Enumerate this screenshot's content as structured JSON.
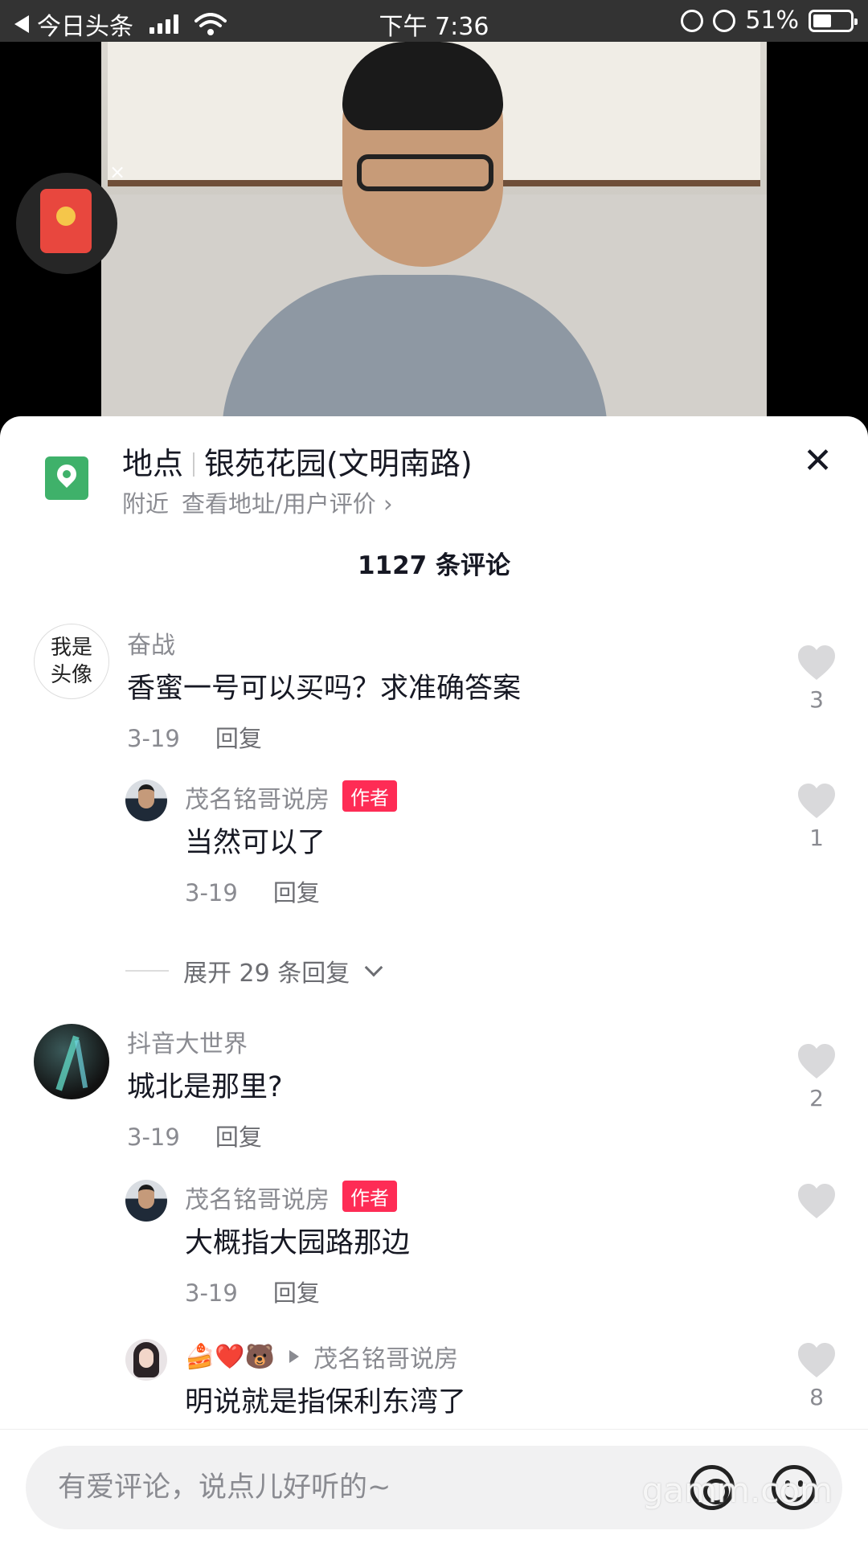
{
  "status_bar": {
    "app_name": "今日头条",
    "time": "下午 7:36",
    "battery": "51%",
    "battery_level": 0.51
  },
  "video": {
    "packet_close": "×"
  },
  "location": {
    "label": "地点",
    "name": "银苑花园(文明南路)",
    "nearby": "附近",
    "link": "查看地址/用户评价 ›",
    "close": "✕"
  },
  "comments_count": "1127 条评论",
  "comments": [
    {
      "avatar_text": "我是头像",
      "user": "奋战",
      "text": "香蜜一号可以买吗？求准确答案",
      "date": "3-19",
      "reply": "回复",
      "likes": "3"
    },
    {
      "user": "茂名铭哥说房",
      "badge": "作者",
      "text": "当然可以了",
      "date": "3-19",
      "reply": "回复",
      "likes": "1"
    },
    {
      "user": "抖音大世界",
      "text": "城北是那里?",
      "date": "3-19",
      "reply": "回复",
      "likes": "2"
    },
    {
      "user": "茂名铭哥说房",
      "badge": "作者",
      "text": "大概指大园路那边",
      "date": "3-19",
      "reply": "回复",
      "likes": ""
    },
    {
      "user_emoji": "🍰❤️🐻",
      "reply_to": "茂名铭哥说房",
      "text": "明说就是指保利东湾了",
      "likes": "8"
    }
  ],
  "expand_replies": "展开 29 条回复",
  "input": {
    "placeholder": "有爱评论，说点儿好听的~"
  },
  "watermark": "gamm.com",
  "colors": {
    "accent_red": "#fe2c55",
    "location_green": "#3fb16a",
    "text_primary": "#161823",
    "text_secondary": "#8a8b91"
  },
  "icons": [
    "back-icon",
    "signal-icon",
    "wifi-icon",
    "lock-rotation-icon",
    "alarm-icon",
    "battery-icon",
    "red-packet-icon",
    "location-pin-icon",
    "close-icon",
    "heart-icon",
    "chevron-down-icon",
    "play-triangle-icon",
    "at-icon",
    "emoji-icon"
  ]
}
